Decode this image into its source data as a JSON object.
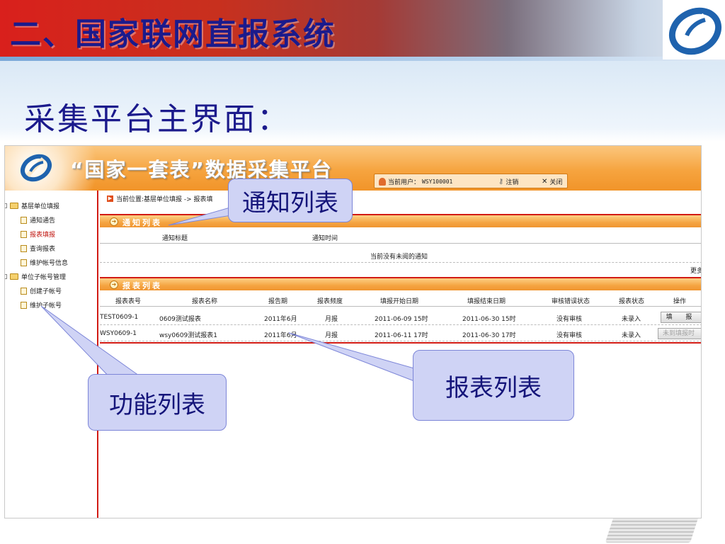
{
  "slide": {
    "title": "二、国家联网直报系统",
    "subtitle": "采集平台主界面："
  },
  "app": {
    "title": "“国家一套表”数据采集平台",
    "current_user_label": "当前用户：",
    "current_user": "WSY100001",
    "logout_label": "注销",
    "close_label": "关闭"
  },
  "sidebar": {
    "groups": [
      {
        "label": "基层单位填报",
        "items": [
          {
            "label": "通知通告"
          },
          {
            "label": "报表填报"
          },
          {
            "label": "查询报表"
          },
          {
            "label": "维护帐号信息"
          }
        ]
      },
      {
        "label": "单位子帐号管理",
        "items": [
          {
            "label": "创建子帐号"
          },
          {
            "label": "维护子帐号"
          }
        ]
      }
    ]
  },
  "main": {
    "breadcrumb": "当前位置:基层单位填报 -> 报表填",
    "notice_section": {
      "title": "通知列表",
      "columns": [
        "通知标题",
        "通知时间"
      ],
      "empty_text": "当前没有未阅的通知",
      "more_label": "更多"
    },
    "report_section": {
      "title": "报表列表",
      "columns": [
        "报表表号",
        "报表名称",
        "报告期",
        "报表频度",
        "填报开始日期",
        "填报结束日期",
        "审核错误状态",
        "报表状态",
        "操作"
      ],
      "rows": [
        [
          "TEST0609-1",
          "0609测试报表",
          "2011年6月",
          "月报",
          "2011-06-09 15时",
          "2011-06-30 15时",
          "没有审核",
          "未录入",
          "填 报"
        ],
        [
          "WSY0609-1",
          "wsy0609测试报表1",
          "2011年6月",
          "月报",
          "2011-06-11 17时",
          "2011-06-30 17时",
          "没有审核",
          "未录入",
          "未到填报时间"
        ]
      ]
    }
  },
  "callouts": {
    "notice_list": "通知列表",
    "function_list": "功能列表",
    "report_list": "报表列表"
  },
  "colors": {
    "title_blue": "#1b1a8c",
    "header_orange": "#f6a43f",
    "accent_red": "#d21b14",
    "callout_fill": "#cfd3f5"
  }
}
